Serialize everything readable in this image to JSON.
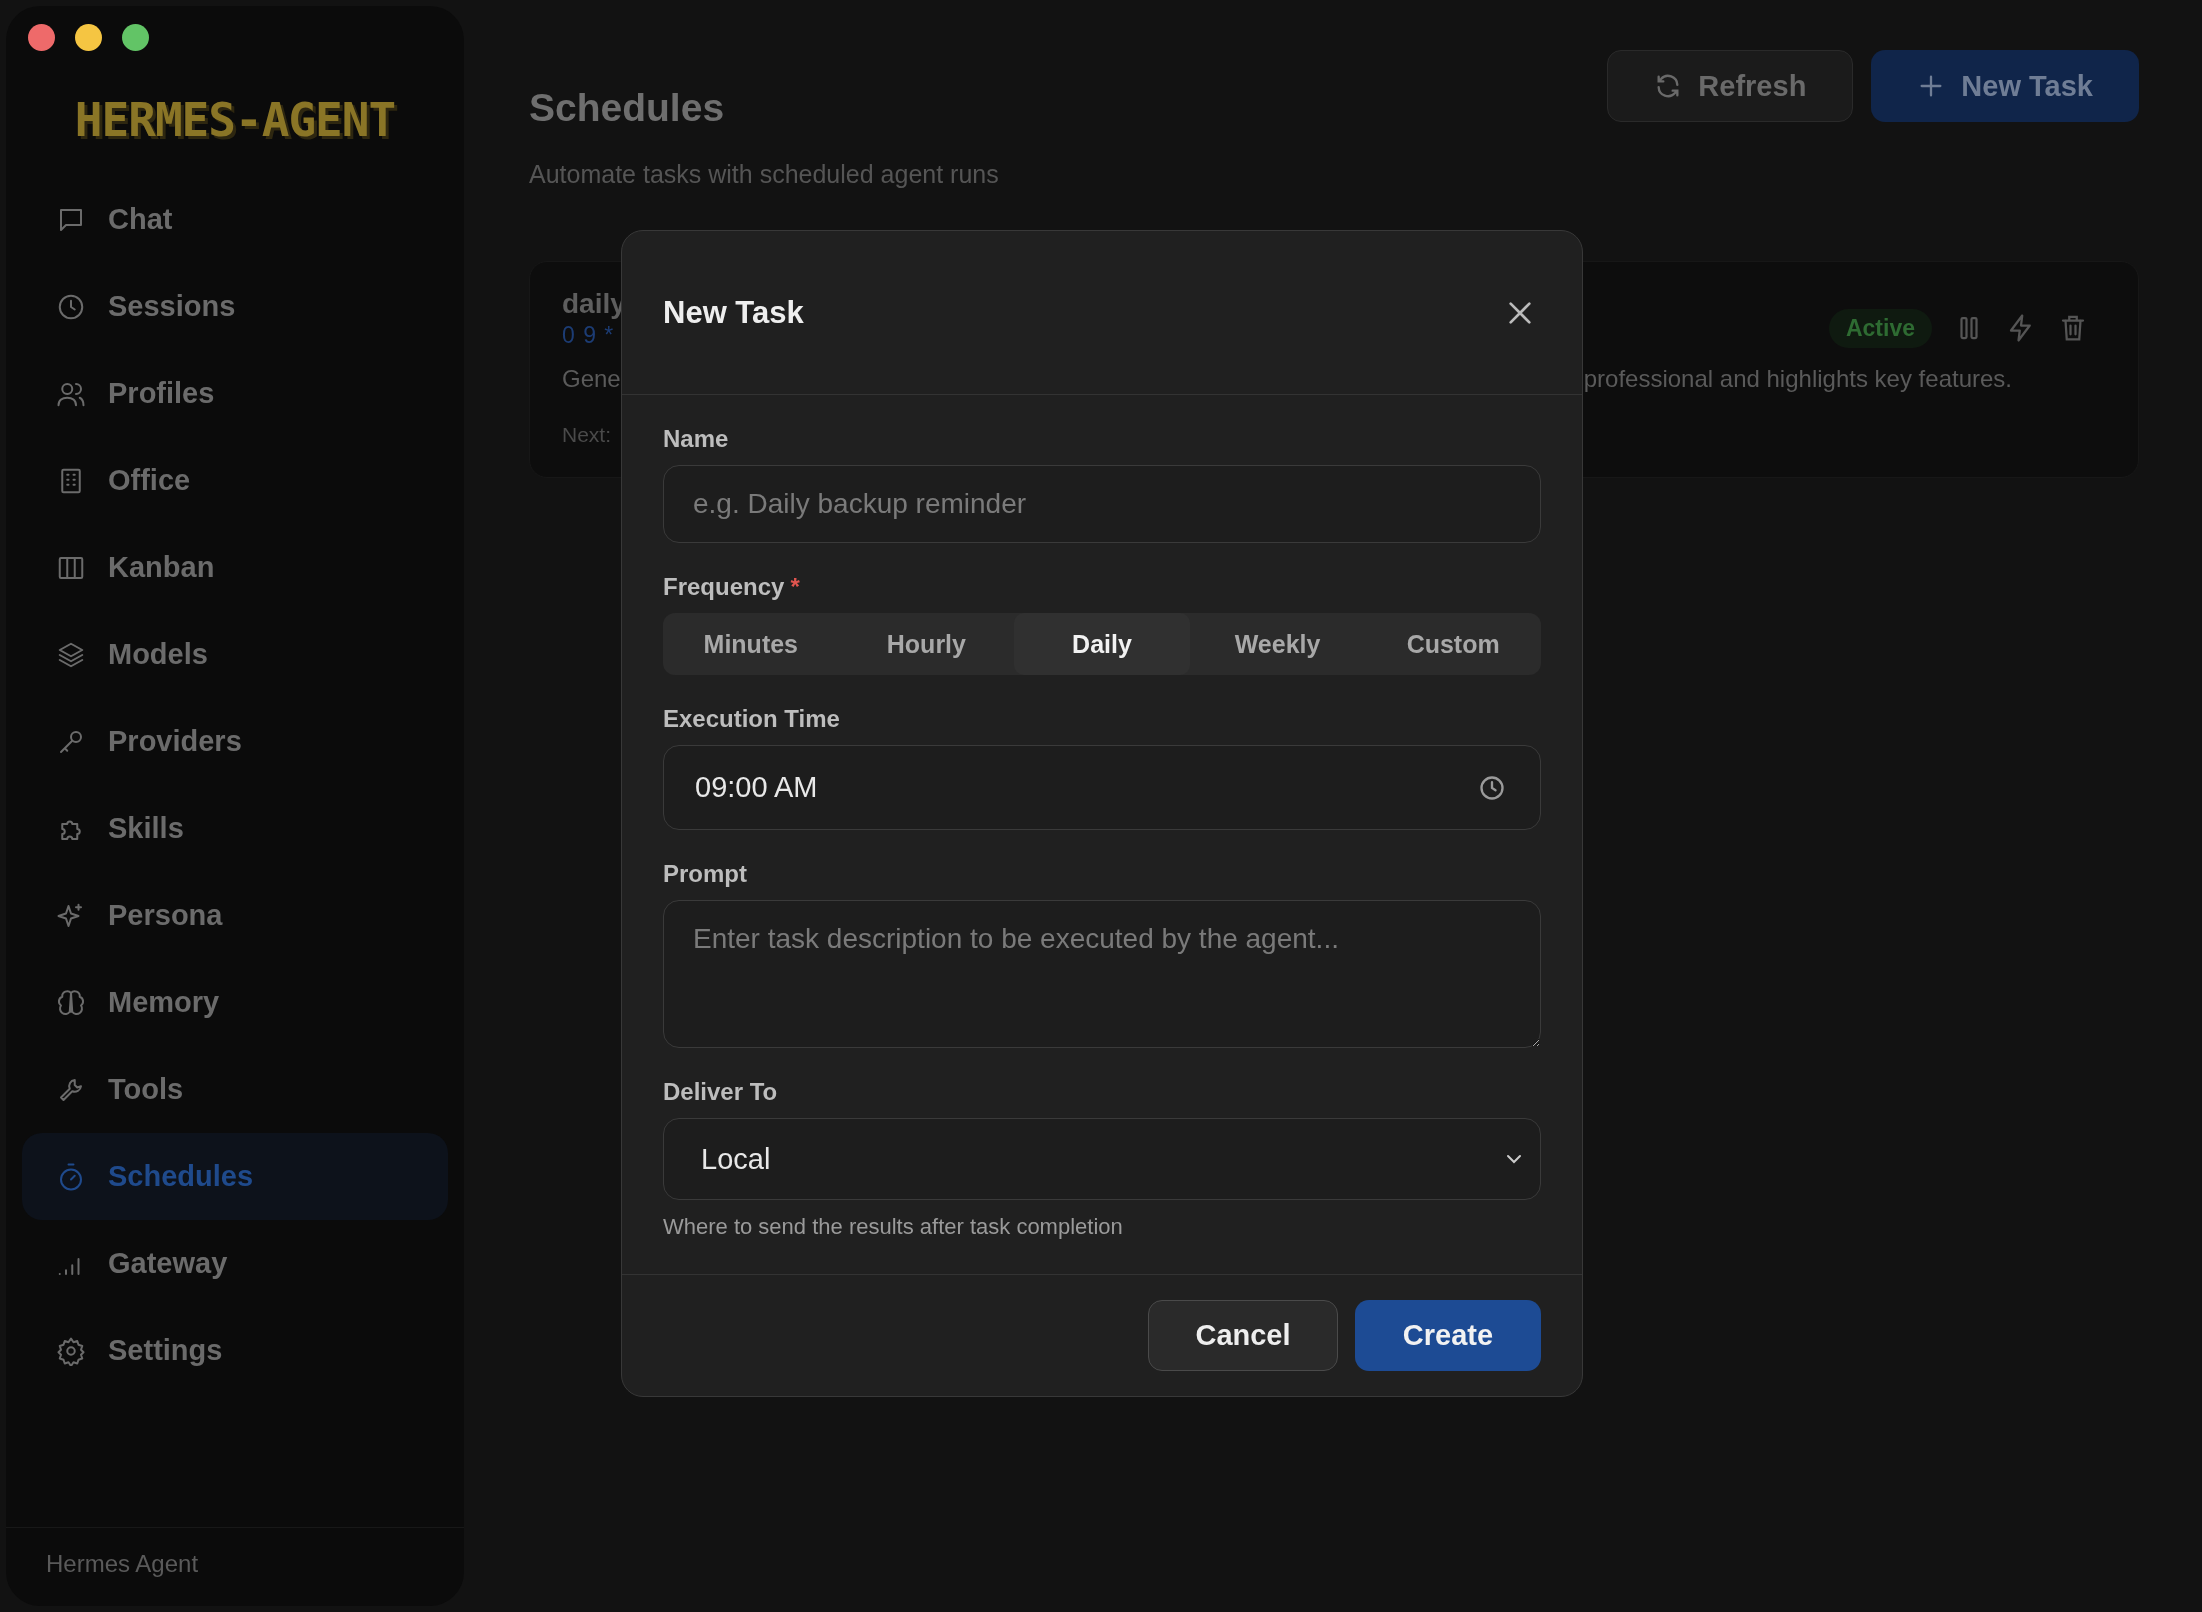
{
  "window_controls": [
    {
      "color": "#ee6a6a"
    },
    {
      "color": "#f5c542"
    },
    {
      "color": "#62c466"
    }
  ],
  "sidebar": {
    "logo": "HERMES-AGENT",
    "items": [
      {
        "label": "Chat",
        "selected": false
      },
      {
        "label": "Sessions",
        "selected": false
      },
      {
        "label": "Profiles",
        "selected": false
      },
      {
        "label": "Office",
        "selected": false
      },
      {
        "label": "Kanban",
        "selected": false
      },
      {
        "label": "Models",
        "selected": false
      },
      {
        "label": "Providers",
        "selected": false
      },
      {
        "label": "Skills",
        "selected": false
      },
      {
        "label": "Persona",
        "selected": false
      },
      {
        "label": "Memory",
        "selected": false
      },
      {
        "label": "Tools",
        "selected": false
      },
      {
        "label": "Schedules",
        "selected": true
      },
      {
        "label": "Gateway",
        "selected": false
      },
      {
        "label": "Settings",
        "selected": false
      }
    ],
    "footer": "Hermes Agent"
  },
  "page": {
    "title": "Schedules",
    "subtitle": "Automate tasks with scheduled agent runs",
    "buttons": [
      {
        "label": "Refresh",
        "kind": "secondary"
      },
      {
        "label": "New Task",
        "kind": "primary"
      }
    ],
    "task_card": {
      "title": "daily",
      "schedule": "0 9 *",
      "description_start": "Gene",
      "description_end": "professional and highlights key features.",
      "next": "Next:",
      "status": "Active"
    }
  },
  "modal": {
    "title": "New Task",
    "name": {
      "label": "Name",
      "placeholder": "e.g. Daily backup reminder"
    },
    "frequency": {
      "label": "Frequency",
      "required_mark": "*",
      "options": [
        {
          "label": "Minutes",
          "selected": false
        },
        {
          "label": "Hourly",
          "selected": false
        },
        {
          "label": "Daily",
          "selected": true
        },
        {
          "label": "Weekly",
          "selected": false
        },
        {
          "label": "Custom",
          "selected": false
        }
      ]
    },
    "execution_time": {
      "label": "Execution Time",
      "value": "09:00 AM"
    },
    "prompt": {
      "label": "Prompt",
      "placeholder": "Enter task description to be executed by the agent..."
    },
    "deliver_to": {
      "label": "Deliver To",
      "value": "Local",
      "hint": "Where to send the results after task completion"
    },
    "buttons": [
      {
        "label": "Cancel",
        "kind": "secondary"
      },
      {
        "label": "Create",
        "kind": "primary"
      }
    ]
  }
}
